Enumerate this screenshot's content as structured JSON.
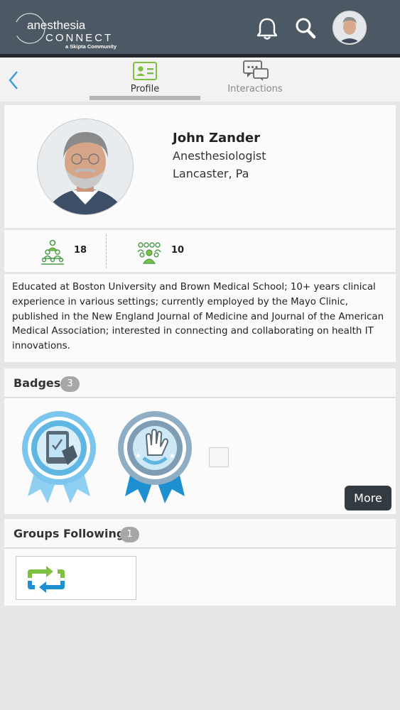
{
  "app": {
    "logo_text": "anesthesia CONNECT",
    "logo_subtext": "a Skipta Community"
  },
  "header": {
    "icons": [
      "bell-icon",
      "search-icon",
      "avatar"
    ]
  },
  "tabs": [
    {
      "label": "Profile",
      "icon": "profile-card-icon",
      "active": true
    },
    {
      "label": "Interactions",
      "icon": "chat-bubbles-icon",
      "active": false
    }
  ],
  "profile": {
    "name": "John Zander",
    "title": "Anesthesiologist",
    "location": "Lancaster, Pa"
  },
  "stats": {
    "connections": "18",
    "groups": "10"
  },
  "bio": "Educated at Boston University and Brown Medical School; 10+ years clinical experience in various settings; currently employed by the Mayo Clinic, published in the New England Journal of Medicine and Journal of the American Medical Association; interested in connecting and collaborating on health IT innovations.",
  "badges": {
    "title": "Badges",
    "count": "3",
    "more_label": "More"
  },
  "groups": {
    "title": "Groups Following",
    "count": "1"
  },
  "colors": {
    "header_bg": "#4c5863",
    "accent_green": "#7ec142",
    "badge_blue": "#5fb6e3"
  }
}
